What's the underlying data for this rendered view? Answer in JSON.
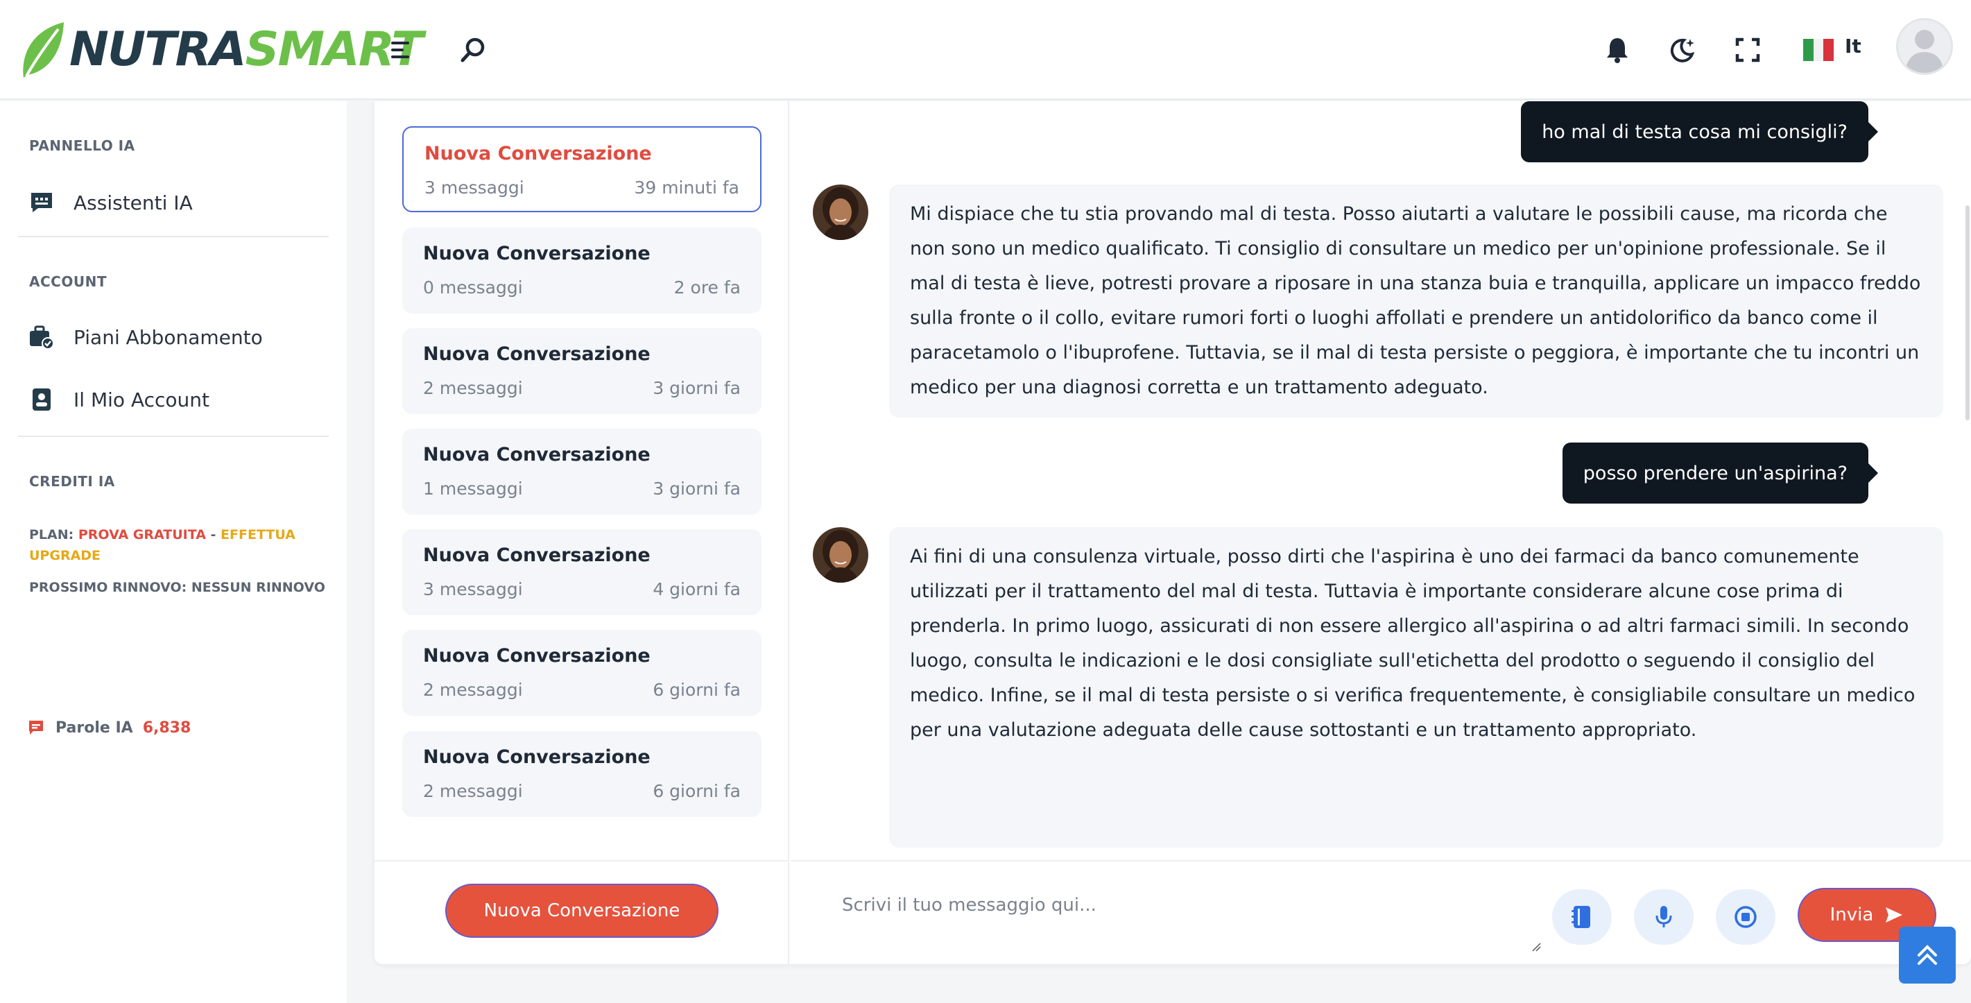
{
  "header": {
    "logo_part1": "NUTRA",
    "logo_part2": "SMART",
    "language": "It",
    "colors": {
      "brand_dark": "#243b4a",
      "brand_green": "#6cc04a"
    }
  },
  "sidebar": {
    "section_ai": "PANNELLO IA",
    "item_assistants": "Assistenti IA",
    "section_account": "ACCOUNT",
    "item_plans": "Piani Abbonamento",
    "item_my_account": "Il Mio Account",
    "section_credits": "CREDITI IA",
    "plan_prefix": "PLAN:",
    "plan_name": "PROVA GRATUITA",
    "plan_sep": " - ",
    "plan_upgrade": "EFFETTUA UPGRADE",
    "renewal": "PROSSIMO RINNOVO: NESSUN RINNOVO",
    "words_label": "Parole IA",
    "words_value": "6,838"
  },
  "conversations": [
    {
      "title": "Nuova Conversazione",
      "messages": "3 messaggi",
      "time": "39 minuti fa",
      "active": true
    },
    {
      "title": "Nuova Conversazione",
      "messages": "0 messaggi",
      "time": "2 ore fa"
    },
    {
      "title": "Nuova Conversazione",
      "messages": "2 messaggi",
      "time": "3 giorni fa"
    },
    {
      "title": "Nuova Conversazione",
      "messages": "1 messaggi",
      "time": "3 giorni fa"
    },
    {
      "title": "Nuova Conversazione",
      "messages": "3 messaggi",
      "time": "4 giorni fa"
    },
    {
      "title": "Nuova Conversazione",
      "messages": "2 messaggi",
      "time": "6 giorni fa"
    },
    {
      "title": "Nuova Conversazione",
      "messages": "2 messaggi",
      "time": "6 giorni fa"
    }
  ],
  "chat": {
    "user_msg_1": "ho mal di testa cosa mi consigli?",
    "bot_msg_1": "Mi dispiace che tu stia provando mal di testa. Posso aiutarti a valutare le possibili cause, ma ricorda che non sono un medico qualificato. Ti consiglio di consultare un medico per un'opinione professionale. Se il mal di testa è lieve, potresti provare a riposare in una stanza buia e tranquilla, applicare un impacco freddo sulla fronte o il collo, evitare rumori forti o luoghi affollati e prendere un antidolorifico da banco come il paracetamolo o l'ibuprofene. Tuttavia, se il mal di testa persiste o peggiora, è importante che tu incontri un medico per una diagnosi corretta e un trattamento adeguato.",
    "user_msg_2": "posso prendere un'aspirina?",
    "bot_msg_2": "Ai fini di una consulenza virtuale, posso dirti che l'aspirina è uno dei farmaci da banco comunemente utilizzati per il trattamento del mal di testa. Tuttavia è importante considerare alcune cose prima di prenderla. In primo luogo, assicurati di non essere allergico all'aspirina o ad altri farmaci simili. In secondo luogo, consulta le indicazioni e le dosi consigliate sull'etichetta del prodotto o seguendo il consiglio del medico. Infine, se il mal di testa persiste o si verifica frequentemente, è consigliabile consultare un medico per una valutazione adeguata delle cause sottostanti e un trattamento appropriato."
  },
  "footer": {
    "new_conversation_button": "Nuova Conversazione",
    "input_placeholder": "Scrivi il tuo messaggio qui...",
    "send_button": "Invia",
    "accent": "#e5533d"
  }
}
